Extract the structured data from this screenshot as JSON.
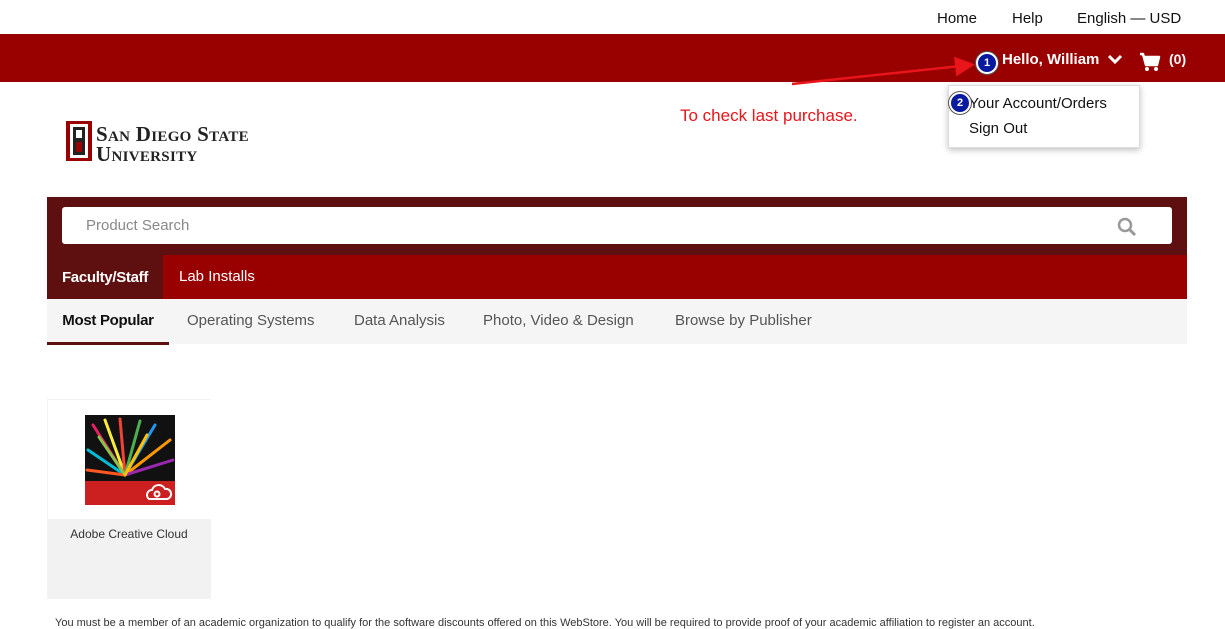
{
  "utility_nav": {
    "home": "Home",
    "help": "Help",
    "locale": "English — USD"
  },
  "header": {
    "greeting": "Hello, William",
    "cart_count": "(0)"
  },
  "account_dropdown": {
    "items": [
      "Your Account/Orders",
      "Sign Out"
    ]
  },
  "annotations": {
    "note": "To check last purchase.",
    "step1": "1",
    "step2": "2",
    "color": "#e8151b"
  },
  "logo": {
    "line1": "San Diego State",
    "line2": "University"
  },
  "search": {
    "placeholder": "Product Search"
  },
  "tabs": [
    {
      "label": "Faculty/Staff"
    },
    {
      "label": "Lab Installs"
    }
  ],
  "categories": [
    {
      "label": "Most Popular"
    },
    {
      "label": "Operating Systems"
    },
    {
      "label": "Data Analysis"
    },
    {
      "label": "Photo, Video & Design"
    },
    {
      "label": "Browse by Publisher"
    }
  ],
  "products": [
    {
      "name": "Adobe Creative Cloud"
    }
  ],
  "footer": {
    "notice": "You must be a member of an academic organization to qualify for the software discounts offered on this WebStore. You will be required to provide proof of your academic affiliation to register an account."
  },
  "colors": {
    "brand_red": "#990000",
    "dark_red": "#5e0f0f"
  }
}
